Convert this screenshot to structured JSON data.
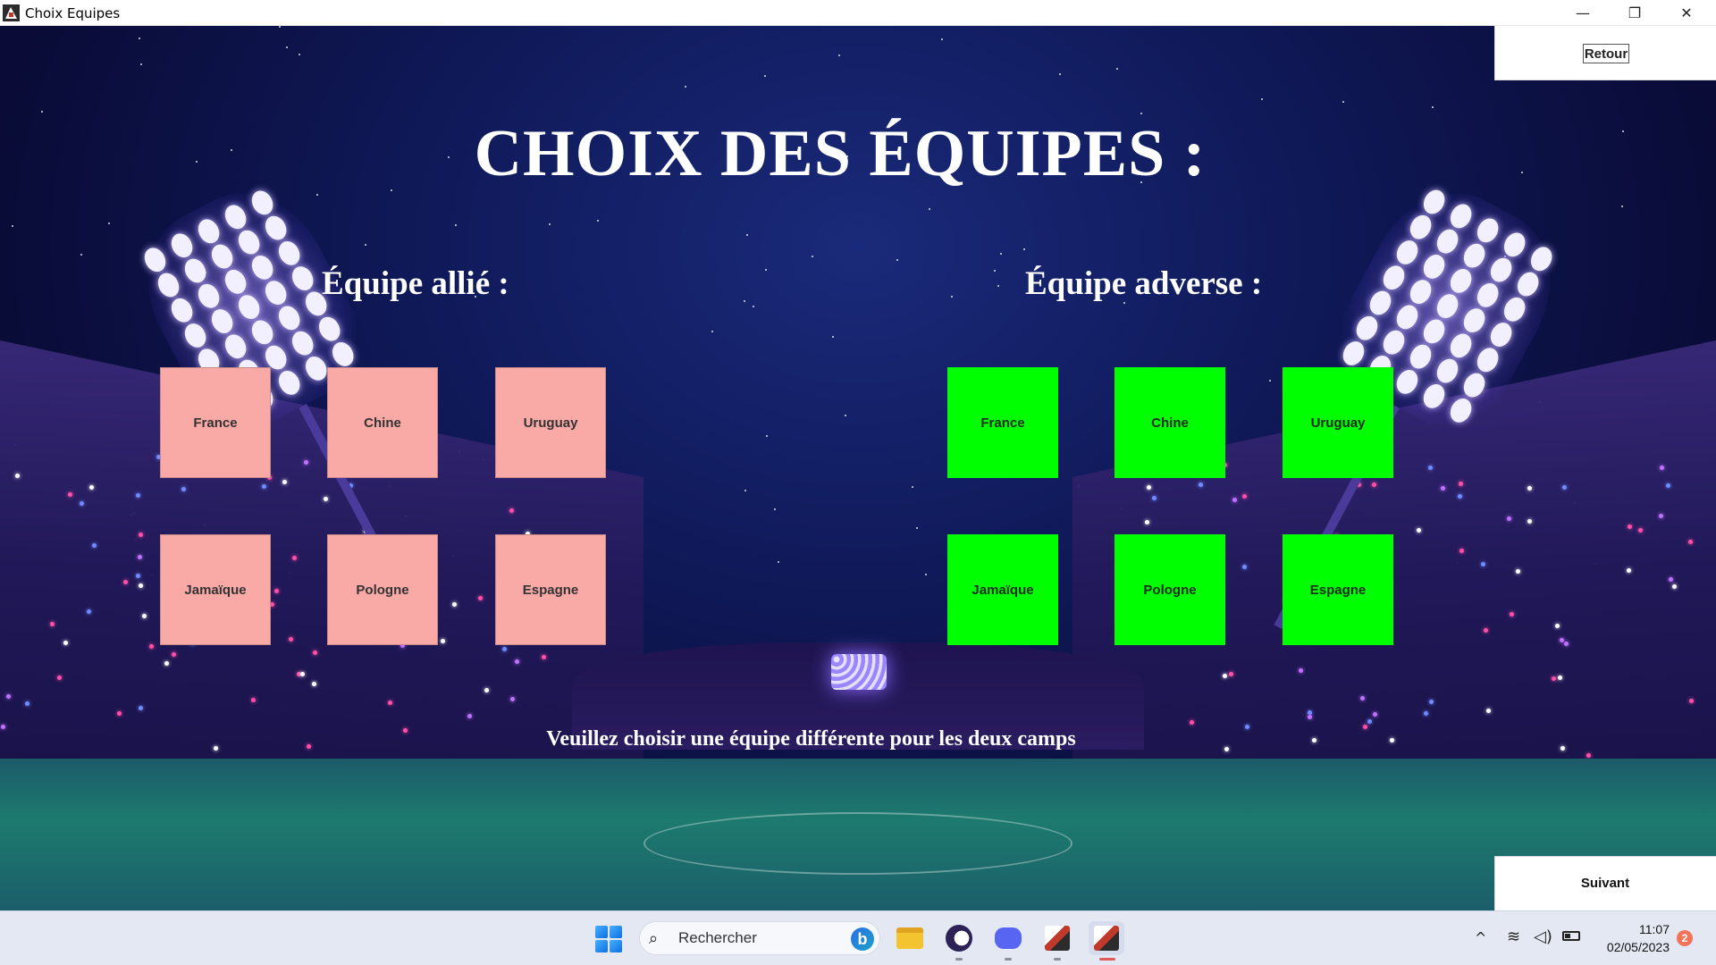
{
  "window": {
    "title": "Choix Equipes",
    "controls": {
      "minimize": "—",
      "maximize": "❐",
      "close": "✕"
    }
  },
  "nav": {
    "back_label": "Retour",
    "next_label": "Suivant"
  },
  "page": {
    "title": "CHOIX DES ÉQUIPES :",
    "ally_heading": "Équipe allié :",
    "enemy_heading": "Équipe adverse :",
    "footer_message": "Veuillez choisir une équipe différente pour les deux camps"
  },
  "ally_teams": [
    "France",
    "Chine",
    "Uruguay",
    "Jamaïque",
    "Pologne",
    "Espagne"
  ],
  "enemy_teams": [
    "France",
    "Chine",
    "Uruguay",
    "Jamaïque",
    "Pologne",
    "Espagne"
  ],
  "colors": {
    "ally_button": "#f9a9a6",
    "enemy_button": "#00ff00",
    "background": "#0c0b3a"
  },
  "taskbar": {
    "search_placeholder": "Rechercher",
    "time": "11:07",
    "date": "02/05/2023",
    "notification_count": "2",
    "icons": [
      "windows-start-icon",
      "search-icon",
      "bing-icon",
      "file-explorer-icon",
      "eclipse-icon",
      "discord-icon",
      "game-app-icon",
      "game-app-icon-active",
      "chevron-up-icon",
      "wifi-icon",
      "volume-icon",
      "battery-icon"
    ]
  }
}
